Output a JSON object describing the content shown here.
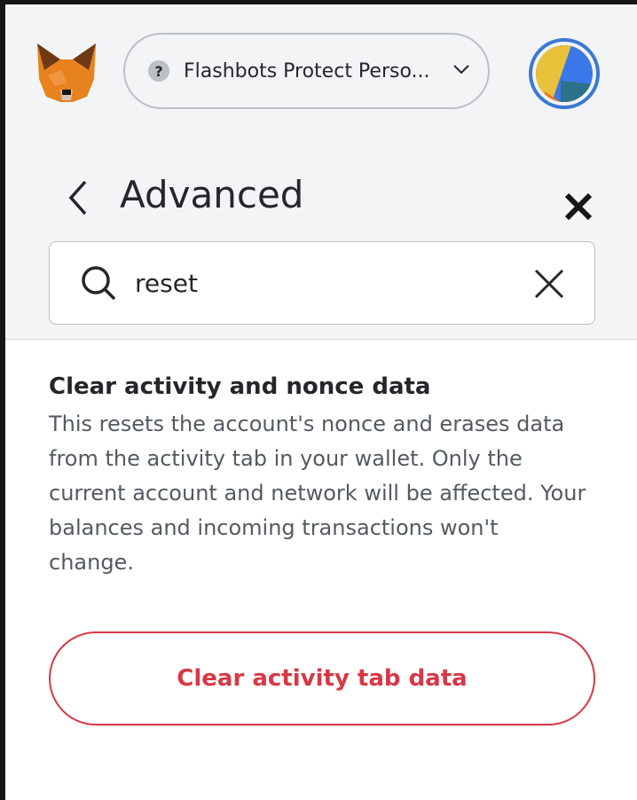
{
  "header": {
    "network_name": "Flashbots Protect Perso...",
    "network_icon": "?"
  },
  "page": {
    "title": "Advanced"
  },
  "search": {
    "value": "reset"
  },
  "setting": {
    "title": "Clear activity and nonce data",
    "description": "This resets the account's nonce and erases data from the activity tab in your wallet. Only the current account and network will be affected. Your balances and incoming transactions won't change.",
    "button_label": "Clear activity tab data"
  },
  "colors": {
    "accent": "#3b78d4",
    "danger": "#d73847"
  }
}
